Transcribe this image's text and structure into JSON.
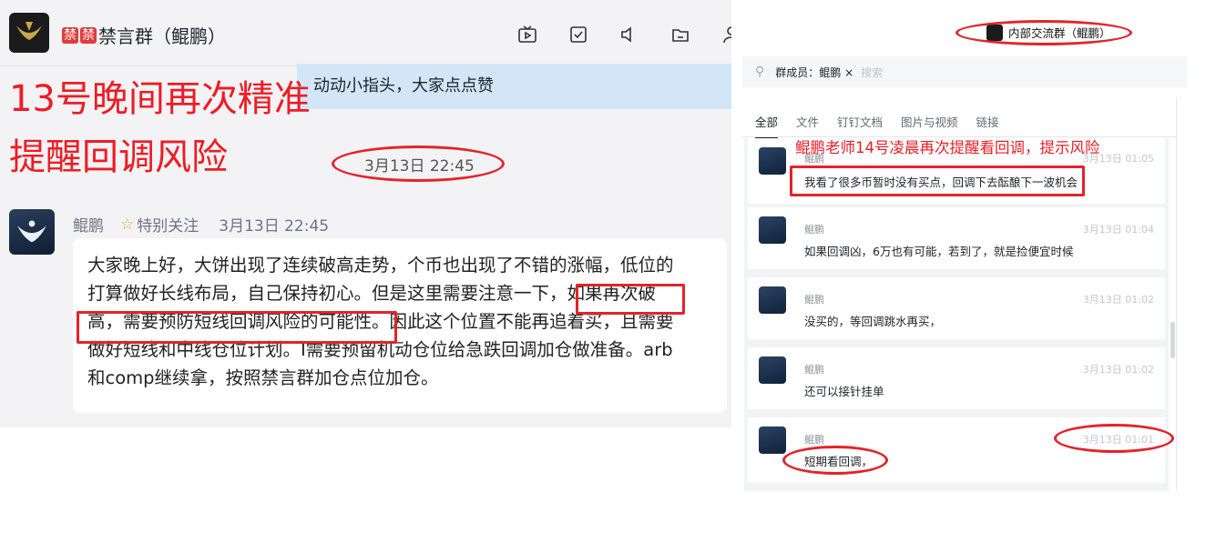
{
  "left_panel": {
    "header": {
      "ban_badges": [
        "禁",
        "禁"
      ],
      "group_name": "禁言群（鲲鹏）",
      "icons": [
        "tv-icon",
        "checkbox-icon",
        "speaker-icon",
        "folder-icon",
        "person-icon"
      ]
    },
    "quoted_message": "动动小指头，大家点点赞",
    "annotation_lines": [
      "13号晚间再次精准",
      "提醒回调风险"
    ],
    "circled_timestamp": "3月13日 22:45",
    "message": {
      "sender": "鲲鹏",
      "tag": "特别关注",
      "time": "3月13日 22:45",
      "lines": [
        "大家晚上好，大饼出现了连续破高走势，个币也出现了不错的涨幅，低位的",
        "打算做好长线布局，自己保持初心。但是这里需要注意一下，如果再次破",
        "高，需要预防短线回调风险的可能性。因此这个位置不能再追着买，且需要",
        "做好短线和中线仓位计划。I需要预留机动仓位给急跌回调加仓做准备。arb",
        "和comp继续拿，按照禁言群加仓点位加仓。"
      ]
    }
  },
  "right_panel": {
    "title": "内部交流群（鲲鹏）",
    "search": {
      "chip": "群成员：鲲鹏 ×",
      "placeholder": "搜索"
    },
    "tabs": [
      "全部",
      "文件",
      "钉钉文档",
      "图片与视频",
      "链接"
    ],
    "annotation": "鲲鹏老师14号凌晨再次提醒看回调，提示风险",
    "messages": [
      {
        "sender": "鲲鹏",
        "time": "3月13日 01:05",
        "text": "我看了很多币暂时没有买点，回调下去酝酿下一波机会"
      },
      {
        "sender": "鲲鹏",
        "time": "3月13日 01:04",
        "text": "如果回调凶，6万也有可能，若到了，就是捡便宜时候"
      },
      {
        "sender": "鲲鹏",
        "time": "3月13日 01:02",
        "text": "没买的，等回调跳水再买，"
      },
      {
        "sender": "鲲鹏",
        "time": "3月13日 01:02",
        "text": "还可以接针挂单"
      },
      {
        "sender": "鲲鹏",
        "time": "3月13日 01:01",
        "text": "短期看回调，"
      }
    ]
  },
  "colors": {
    "annotation_red": "#ee1c25",
    "quote_bg": "#d3e6f7",
    "follow_star": "#f29c1f"
  }
}
